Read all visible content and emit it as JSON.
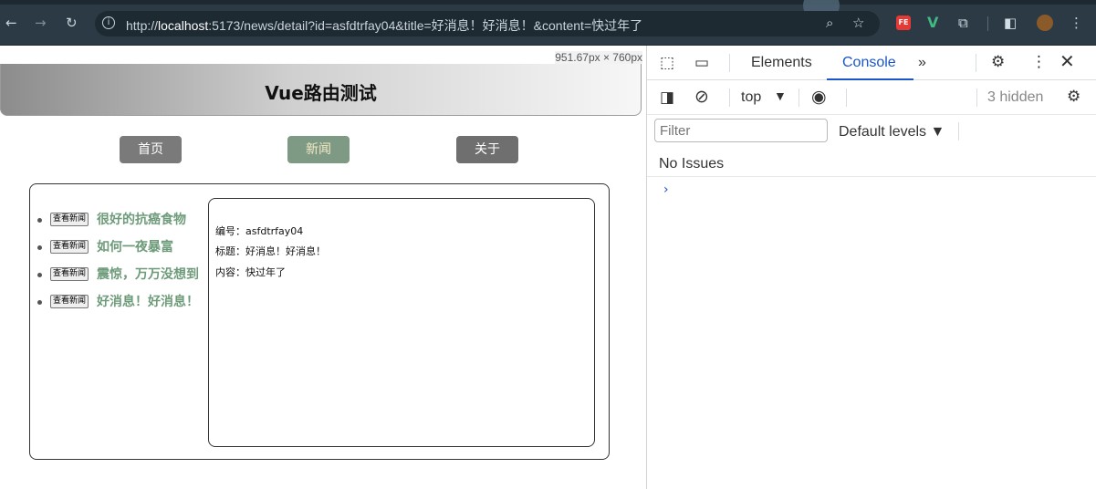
{
  "browser": {
    "back_icon": "arrow-left",
    "forward_icon": "arrow-right",
    "reload_icon": "reload",
    "url_prefix": "http://",
    "url_host": "localhost",
    "url_rest": ":5173/news/detail?id=asfdtrfay04&title=好消息！好消息！&content=快过年了"
  },
  "page": {
    "dimensions_badge": "951.67px × 760px",
    "title": "Vue路由测试",
    "nav": {
      "home": "首页",
      "news": "新闻",
      "about": "关于"
    },
    "news_items": [
      {
        "button": "查看新闻",
        "title": "很好的抗癌食物"
      },
      {
        "button": "查看新闻",
        "title": "如何一夜暴富"
      },
      {
        "button": "查看新闻",
        "title": "震惊，万万没想到"
      },
      {
        "button": "查看新闻",
        "title": "好消息！好消息！"
      }
    ],
    "detail": {
      "id_line": "编号：asfdtrfay04",
      "title_line": "标题：好消息！好消息！",
      "content_line": "内容：快过年了"
    }
  },
  "devtools": {
    "tabs": {
      "elements": "Elements",
      "console": "Console",
      "more": "»"
    },
    "context": "top",
    "hidden_count": "3 hidden",
    "filter_placeholder": "Filter",
    "levels": "Default levels ▼",
    "issues": "No Issues",
    "prompt": "›"
  }
}
